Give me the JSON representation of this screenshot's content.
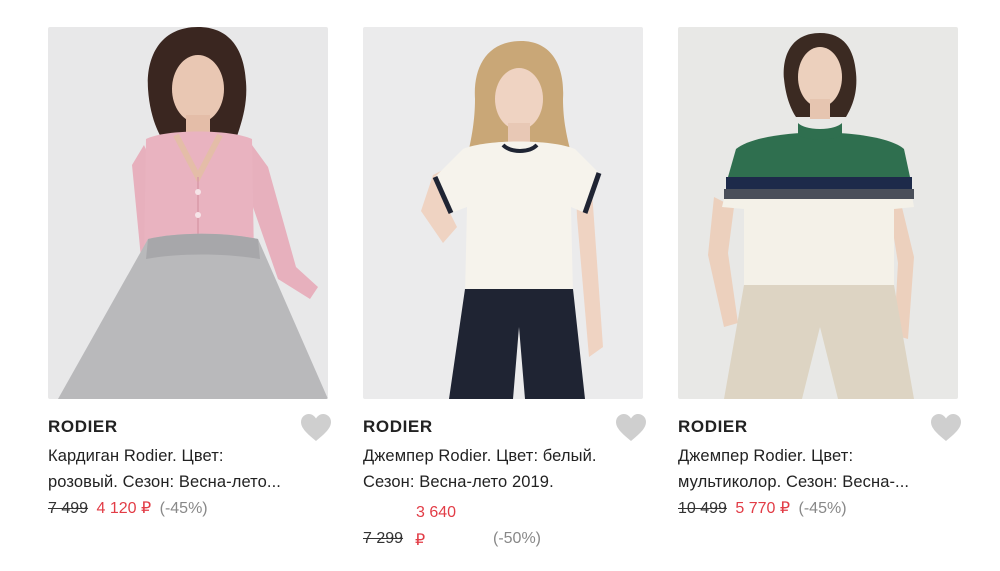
{
  "products": [
    {
      "brand": "RODIER",
      "title_line1": "Кардиган Rodier. Цвет:",
      "title_line2": "розовый. Сезон: Весна-лето...",
      "old_price": "7 499",
      "new_price": "4 120 ₽",
      "discount": "(-45%)"
    },
    {
      "brand": "RODIER",
      "title_line1": "Джемпер Rodier. Цвет: белый.",
      "title_line2": "Сезон: Весна-лето 2019.",
      "new_price": "3 640",
      "old_price": "7 299",
      "currency": "₽",
      "discount": "(-50%)"
    },
    {
      "brand": "RODIER",
      "title_line1": "Джемпер Rodier. Цвет:",
      "title_line2": "мультиколор. Сезон: Весна-...",
      "old_price": "10 499",
      "new_price": "5 770 ₽",
      "discount": "(-45%)"
    }
  ],
  "icons": {
    "favorite": "heart-icon"
  },
  "colors": {
    "sale_price": "#e23c46",
    "discount": "#888888",
    "heart": "#cfcfcf",
    "photo_bg": "#e9e9e9"
  }
}
